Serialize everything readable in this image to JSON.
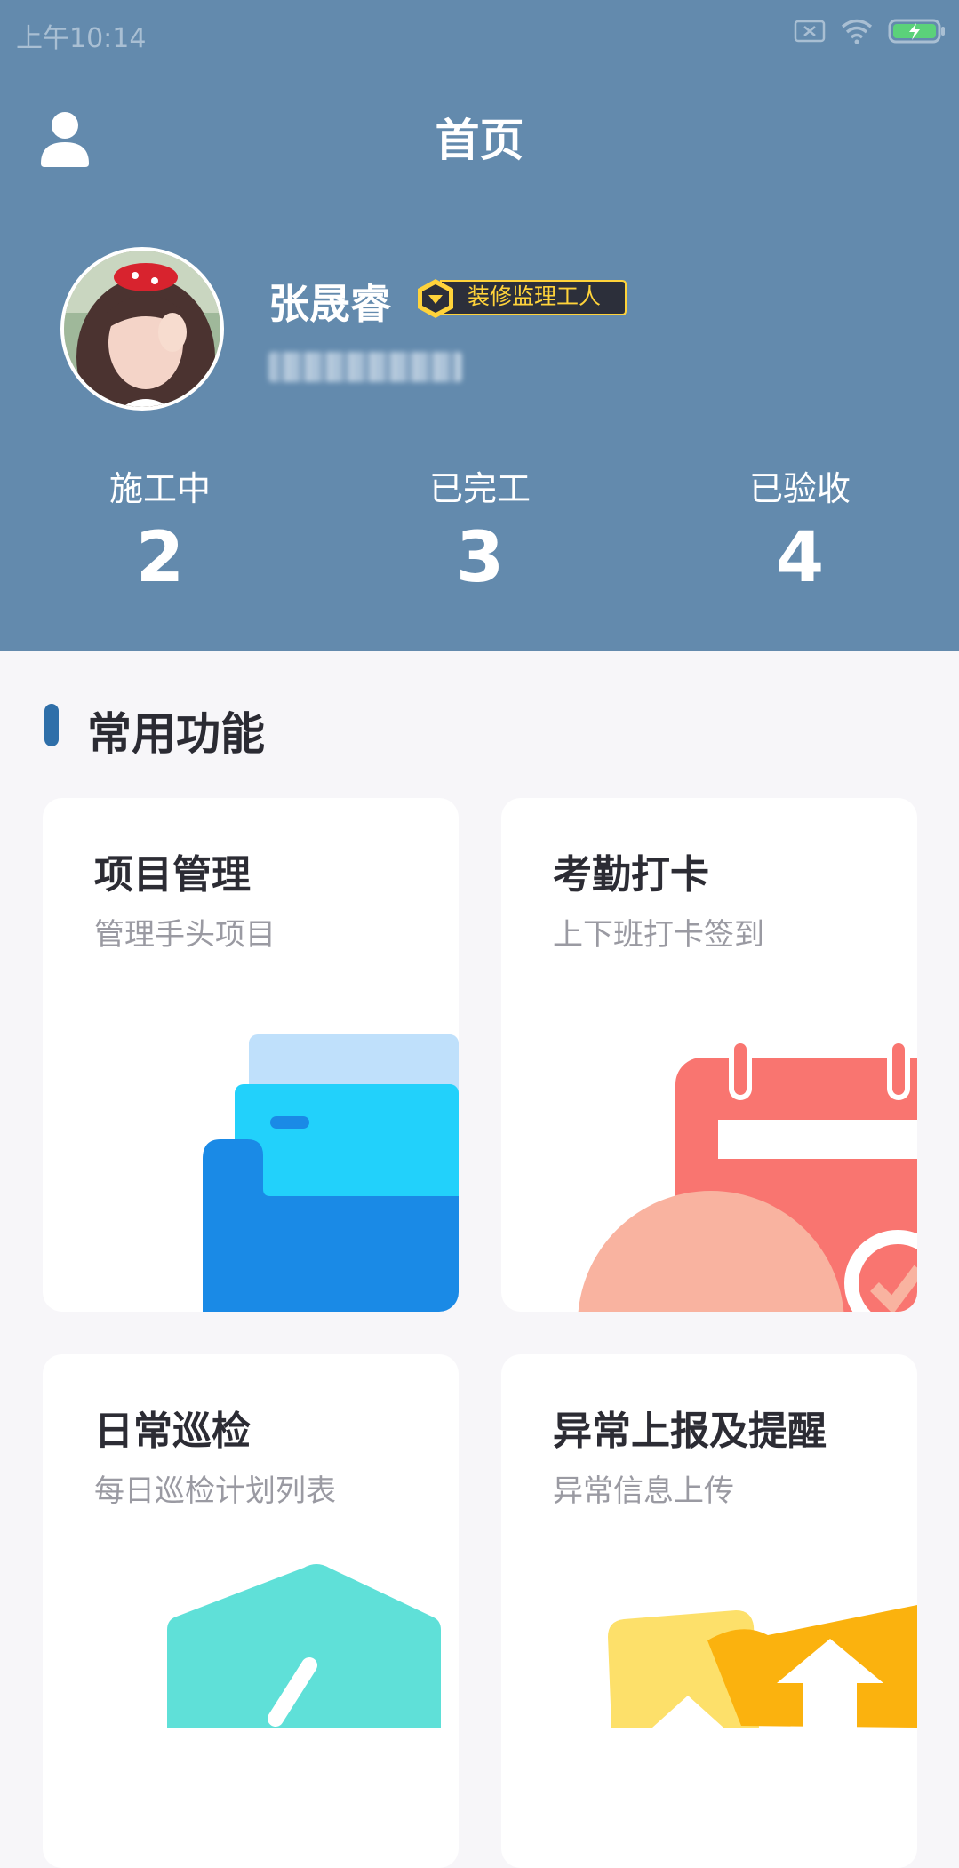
{
  "status_bar": {
    "time": "上午10:14"
  },
  "header": {
    "title": "首页"
  },
  "profile": {
    "name": "张晟睿",
    "role": "装修监理工人"
  },
  "stats": [
    {
      "label": "施工中",
      "value": "2"
    },
    {
      "label": "已完工",
      "value": "3"
    },
    {
      "label": "已验收",
      "value": "4"
    }
  ],
  "section": {
    "title": "常用功能"
  },
  "features": [
    {
      "title": "项目管理",
      "subtitle": "管理手头项目"
    },
    {
      "title": "考勤打卡",
      "subtitle": "上下班打卡签到"
    },
    {
      "title": "日常巡检",
      "subtitle": "每日巡检计划列表"
    },
    {
      "title": "异常上报及提醒",
      "subtitle": "异常信息上传"
    }
  ],
  "colors": {
    "header_bg": "#638aad",
    "badge_bg": "#2c2f3a",
    "badge_text": "#ffd33a",
    "accent_bar": "#2f6fa9"
  }
}
